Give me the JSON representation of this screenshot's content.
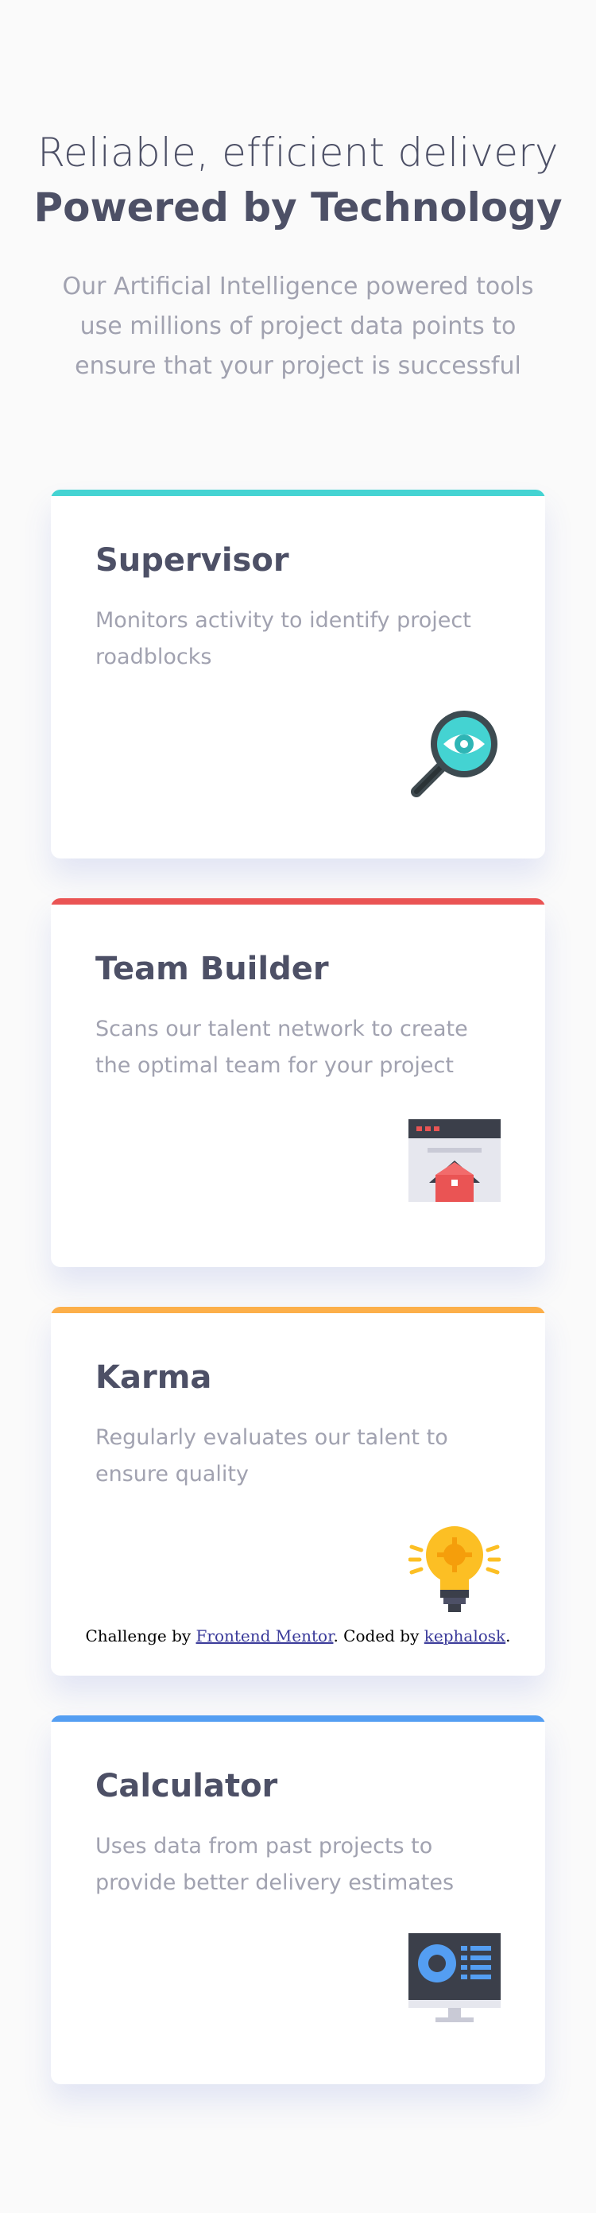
{
  "header": {
    "title_light": "Reliable, efficient delivery",
    "title_bold": "Powered by Technology",
    "intro": "Our Artificial Intelligence powered tools use millions of project data points to ensure that your project is successful"
  },
  "cards": [
    {
      "title": "Supervisor",
      "description": "Monitors activity to identify project roadblocks",
      "accent": "#44d3d2",
      "icon": "magnifier-eye-icon"
    },
    {
      "title": "Team Builder",
      "description": "Scans our talent network to create the optimal team for your project",
      "accent": "#ea5454",
      "icon": "browser-house-icon"
    },
    {
      "title": "Karma",
      "description": "Regularly evaluates our talent to ensure quality",
      "accent": "#fcaf4a",
      "icon": "lightbulb-icon"
    },
    {
      "title": "Calculator",
      "description": "Uses data from past projects to provide better delivery estimates",
      "accent": "#549ef2",
      "icon": "calculator-monitor-icon"
    }
  ],
  "attribution": {
    "prefix": "Challenge by ",
    "link1": "Frontend Mentor",
    "middle": ". Coded by ",
    "link2": "kephalosk",
    "suffix": "."
  }
}
